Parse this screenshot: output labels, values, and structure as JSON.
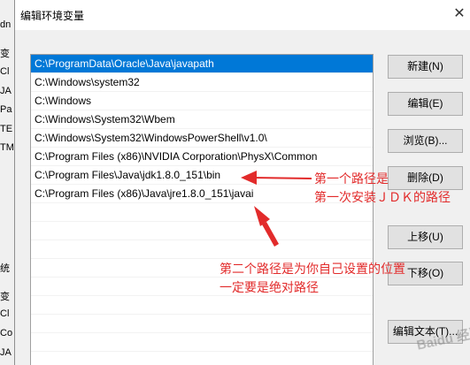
{
  "dialog": {
    "title": "编辑环境变量",
    "close_glyph": "✕",
    "paths": [
      "C:\\ProgramData\\Oracle\\Java\\javapath",
      "C:\\Windows\\system32",
      "C:\\Windows",
      "C:\\Windows\\System32\\Wbem",
      "C:\\Windows\\System32\\WindowsPowerShell\\v1.0\\",
      "C:\\Program Files (x86)\\NVIDIA Corporation\\PhysX\\Common",
      "C:\\Program Files\\Java\\jdk1.8.0_151\\bin",
      "C:\\Program Files (x86)\\Java\\jre1.8.0_151\\javai"
    ],
    "selected_index": 0,
    "buttons": {
      "new": "新建(N)",
      "edit": "编辑(E)",
      "browse": "浏览(B)...",
      "delete": "删除(D)",
      "move_up": "上移(U)",
      "move_down": "下移(O)",
      "edit_text": "编辑文本(T)..."
    }
  },
  "background_window": {
    "snippets": [
      "dn",
      "变",
      "Cl",
      "JA",
      "Pa",
      "TE",
      "TM",
      "统",
      "变",
      "Cl",
      "Co",
      "JA"
    ]
  },
  "annotations": {
    "first_path_line1": "第一个路径是",
    "first_path_line2": "第一次安装ＪＤＫ的路径",
    "second_path_line1": "第二个路径是为你自己设置的位置",
    "second_path_line2": "一定要是绝对路径",
    "color": "#e22b2b"
  },
  "watermark": "Baidu 经验"
}
